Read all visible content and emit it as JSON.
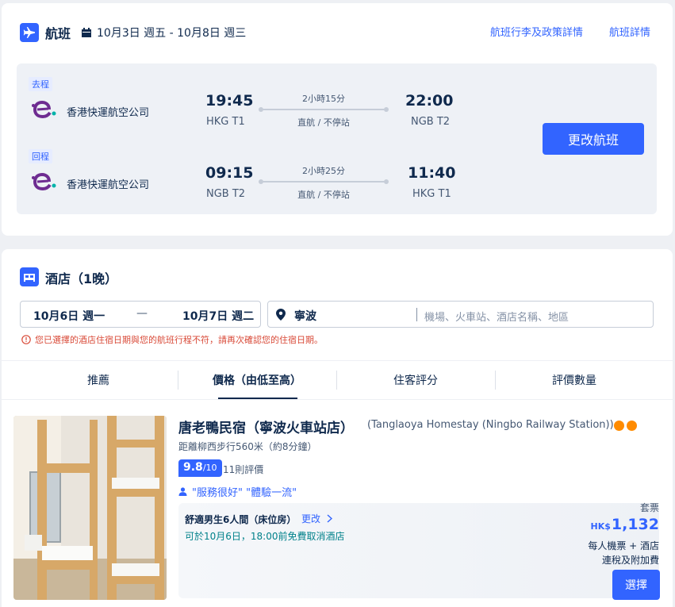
{
  "flight": {
    "title": "航班",
    "date_range": "10月3日 週五 - 10月8日 週三",
    "link_baggage": "航班行李及政策詳情",
    "link_details": "航班詳情",
    "change_button": "更改航班",
    "outbound": {
      "tag": "去程",
      "airline": "香港快運航空公司",
      "depart_time": "19:45",
      "depart_airport": "HKG T1",
      "duration": "2小時15分",
      "stops": "直航 / 不停站",
      "arrive_time": "22:00",
      "arrive_airport": "NGB T2"
    },
    "inbound": {
      "tag": "回程",
      "airline": "香港快運航空公司",
      "depart_time": "09:15",
      "depart_airport": "NGB T2",
      "duration": "2小時25分",
      "stops": "直航 / 不停站",
      "arrive_time": "11:40",
      "arrive_airport": "HKG T1"
    }
  },
  "hotel_section": {
    "title": "酒店（1晚）",
    "checkin": "10月6日 週一",
    "checkout": "10月7日 週二",
    "dash": "—",
    "destination": "寧波",
    "destination_placeholder": "機場、火車站、酒店名稱、地區",
    "warning": "您已選擇的酒店住宿日期與您的航班行程不符，請再次確認您的住宿日期。"
  },
  "sort_tabs": [
    "推薦",
    "價格（由低至高）",
    "住客評分",
    "評價數量"
  ],
  "hotel": {
    "name": "唐老鴨民宿（寧波火車站店）",
    "name_en": "(Tanglaoya Homestay (Ningbo Railway Station))",
    "distance": "距離柳西步行560米（約8分鐘）",
    "score": "9.8",
    "score_max": "/10",
    "reviews": "11則評價",
    "quotes": "\"服務很好\"  \"體驗一流\"",
    "room_name": "舒適男生6人間（床位房）",
    "change_link": "更改",
    "cancel_policy": "可於10月6日，18:00前免費取消酒店",
    "package_label": "套票",
    "currency": "HK$",
    "price": "1,132",
    "per_person": "每人機票 + 酒店",
    "tax_note": "連稅及附加費",
    "select_button": "選擇"
  },
  "colors": {
    "brand_blue": "#3264ff",
    "airline_purple": "#6e2c91",
    "warning_red": "#d94a38",
    "rating_dots": "#ff8b00"
  }
}
